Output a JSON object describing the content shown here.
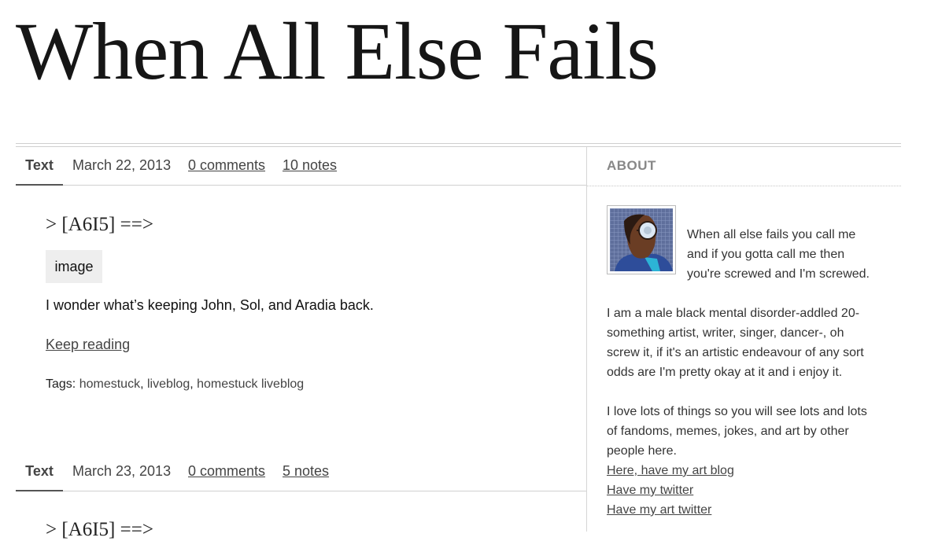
{
  "site": {
    "title": "When All Else Fails"
  },
  "posts": [
    {
      "type": "Text",
      "date": "March 22, 2013",
      "comments": "0 comments",
      "notes": "10 notes",
      "title": "> [A6I5] ==>",
      "image_placeholder": "image",
      "body": "I wonder what’s keeping John, Sol, and Aradia back.",
      "keep_reading": "Keep reading",
      "tags_label": "Tags:",
      "tags": [
        "homestuck",
        "liveblog",
        "homestuck liveblog"
      ]
    },
    {
      "type": "Text",
      "date": "March 23, 2013",
      "comments": "0 comments",
      "notes": "5 notes",
      "title": "> [A6I5] ==>"
    }
  ],
  "sidebar": {
    "heading": "ABOUT",
    "intro": [
      "When all else fails you call me",
      "and if you gotta call me then",
      "you're screwed and I'm screwed."
    ],
    "bio": [
      "I am a male black mental disorder-addled 20-",
      "something artist, writer, singer, dancer-, oh",
      "screw it, if it's an artistic endeavour of any sort",
      "odds are I'm pretty okay at it and i enjoy it."
    ],
    "loves": [
      "I love lots of things so you will see lots and lots",
      "of fandoms, memes, jokes, and art by other",
      "people here."
    ],
    "links": [
      "Here, have my art blog",
      "Have my twitter",
      "Have my art twitter"
    ]
  }
}
